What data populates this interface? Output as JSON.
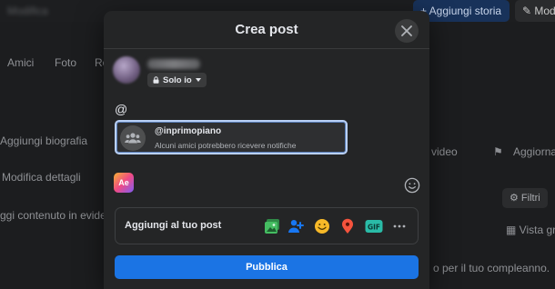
{
  "background": {
    "topbar": {
      "title": "Modifica",
      "add_story": "+ Aggiungi storia",
      "edit": "Modifica"
    },
    "tabs": [
      "Amici",
      "Foto",
      "Ro"
    ],
    "sidebar": {
      "add_bio": "Aggiungi biografia",
      "edit_details": "Modifica dettagli",
      "add_featured": "ggi contenuto in evidenza"
    },
    "right": {
      "video": "video",
      "manage": "Aggiorna",
      "filters": "Filtri",
      "grid_view": "Vista gri",
      "birthday": "o per il tuo compleanno."
    }
  },
  "modal": {
    "title": "Crea post",
    "privacy": "Solo io",
    "editor_text": "@",
    "mention": {
      "name": "@inprimopiano",
      "description": "Alcuni amici potrebbero ricevere notifiche"
    },
    "text_style_label": "Ae",
    "add_to_post": "Aggiungi al tuo post",
    "publish": "Pubblica"
  },
  "colors": {
    "primary": "#1b74e4",
    "photo": "#45bd62",
    "tag": "#1877f2",
    "feeling": "#f7b928",
    "location": "#f5533d",
    "gif": "#2abba7"
  }
}
